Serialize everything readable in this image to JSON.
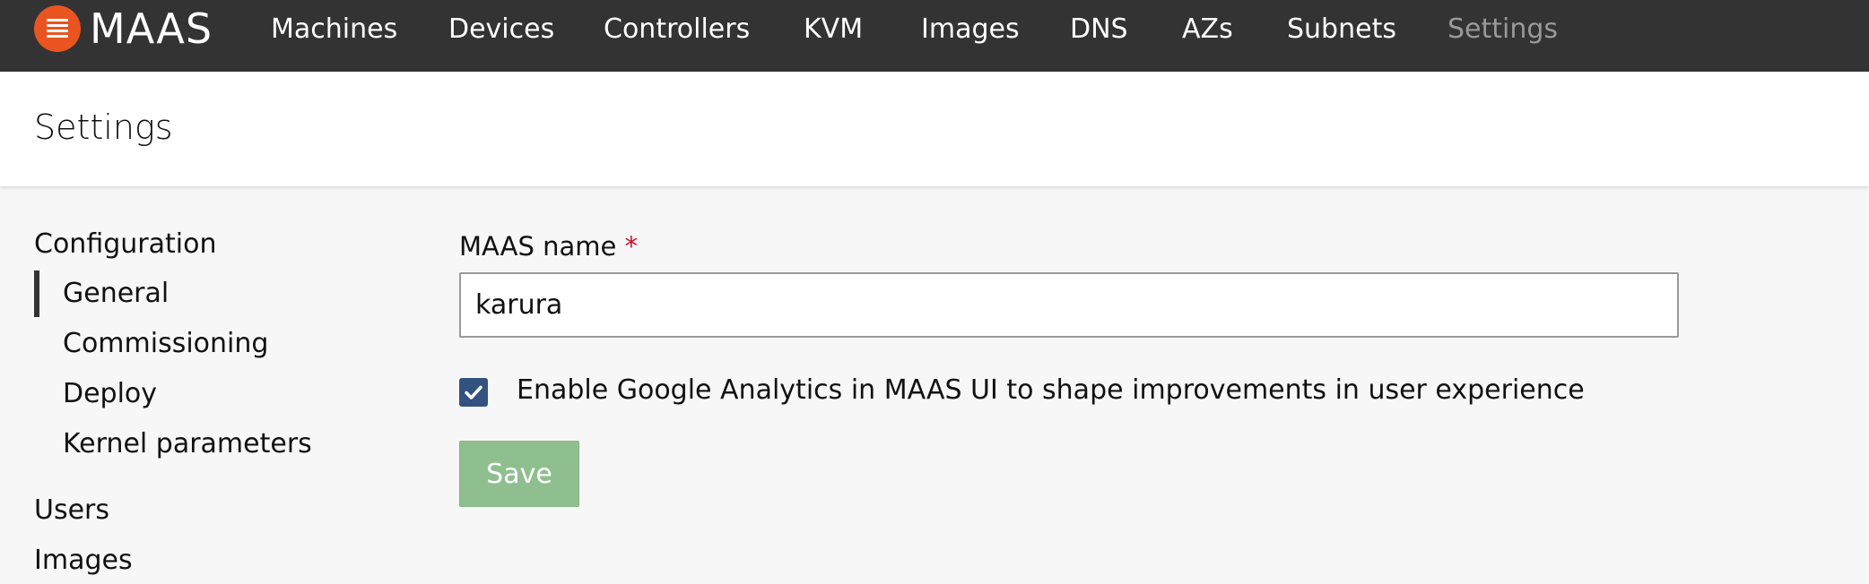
{
  "brand": {
    "name": "MAAS"
  },
  "nav": {
    "items": [
      {
        "label": "Machines"
      },
      {
        "label": "Devices"
      },
      {
        "label": "Controllers"
      },
      {
        "label": "KVM"
      },
      {
        "label": "Images"
      },
      {
        "label": "DNS"
      },
      {
        "label": "AZs"
      },
      {
        "label": "Subnets"
      },
      {
        "label": "Settings",
        "active": true
      }
    ]
  },
  "header": {
    "title": "Settings"
  },
  "sidebar": {
    "configuration": {
      "heading": "Configuration",
      "items": [
        {
          "label": "General",
          "active": true
        },
        {
          "label": "Commissioning"
        },
        {
          "label": "Deploy"
        },
        {
          "label": "Kernel parameters"
        }
      ]
    },
    "users": {
      "heading": "Users"
    },
    "images": {
      "heading": "Images"
    }
  },
  "form": {
    "name_label": "MAAS name",
    "required_marker": "*",
    "name_value": "karura",
    "analytics_checked": true,
    "analytics_label": "Enable Google Analytics in MAAS UI to shape improvements in user experience",
    "save_label": "Save"
  },
  "colors": {
    "navbar": "#333333",
    "logo": "#e95420",
    "checkbox": "#335280",
    "save_button": "#8fbf8f",
    "required": "#c7162b"
  },
  "icons": {
    "logo": "maas-logo-icon",
    "checkbox": "checkmark-icon"
  }
}
